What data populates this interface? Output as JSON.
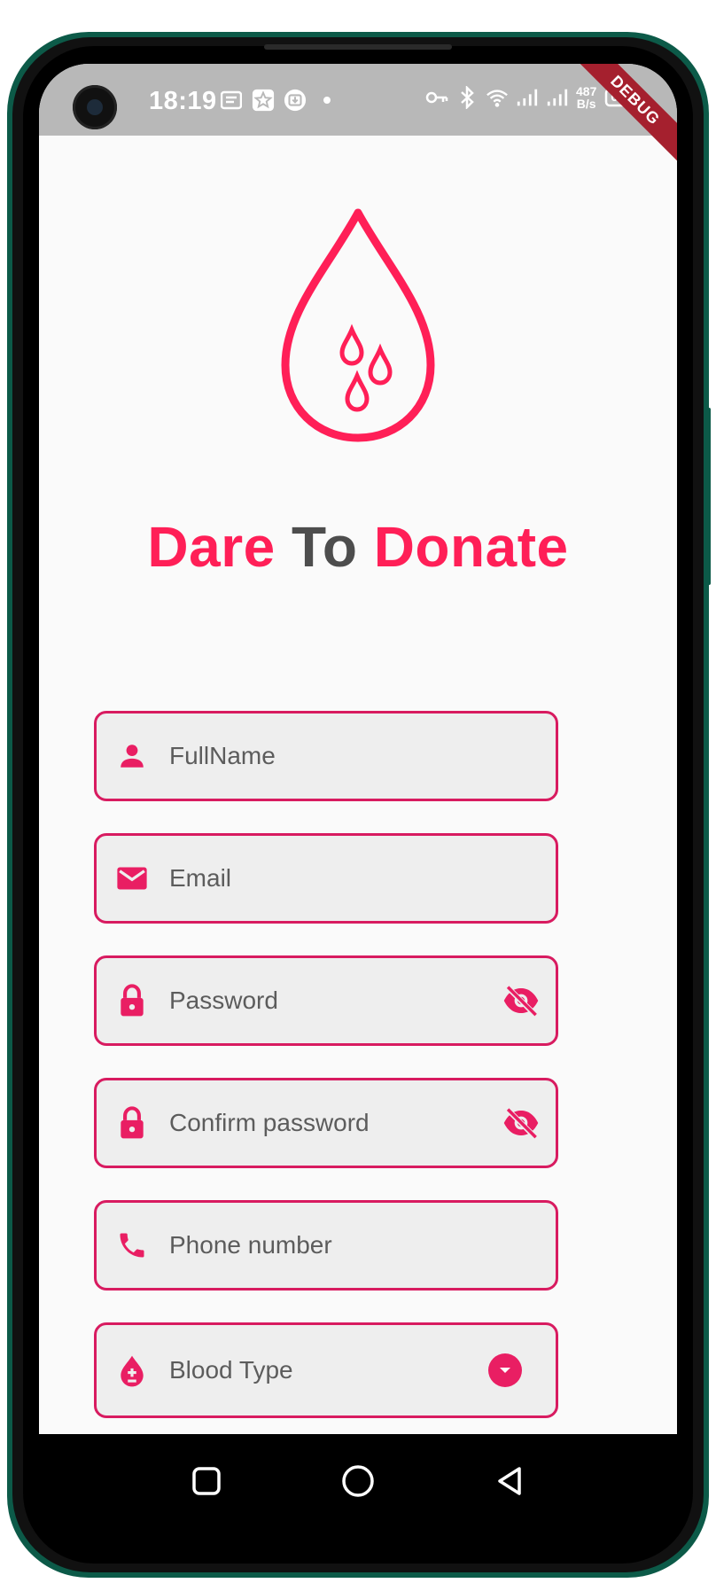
{
  "statusbar": {
    "time": "18:19",
    "net_speed_value": "487",
    "net_speed_unit": "B/s",
    "battery": "61",
    "icons_left": [
      "message-icon",
      "star-notification-icon",
      "download-notification-icon",
      "dot-icon"
    ],
    "icons_right": [
      "vpn-key-icon",
      "bluetooth-icon",
      "wifi-icon",
      "signal-icon",
      "signal-icon-2"
    ]
  },
  "debug_banner": "DEBUG",
  "app": {
    "title_part1": "Dare",
    "title_part2": "To",
    "title_part3": "Donate",
    "accent_color": "#ff1f57",
    "border_color": "#d81b60"
  },
  "form": {
    "fullname": {
      "placeholder": "FullName",
      "icon": "person-icon"
    },
    "email": {
      "placeholder": "Email",
      "icon": "mail-icon"
    },
    "password": {
      "placeholder": "Password",
      "icon": "lock-icon",
      "toggle_icon": "visibility-off-icon"
    },
    "confirm_password": {
      "placeholder": "Confirm password",
      "icon": "lock-icon",
      "toggle_icon": "visibility-off-icon"
    },
    "phone": {
      "placeholder": "Phone number",
      "icon": "phone-icon"
    },
    "blood_type": {
      "label": "Blood Type",
      "icon": "blood-drop-icon",
      "dropdown_icon": "arrow-drop-down-circle-icon"
    }
  },
  "navbar": {
    "icons": [
      "recents-square-icon",
      "home-circle-icon",
      "back-triangle-icon"
    ]
  }
}
